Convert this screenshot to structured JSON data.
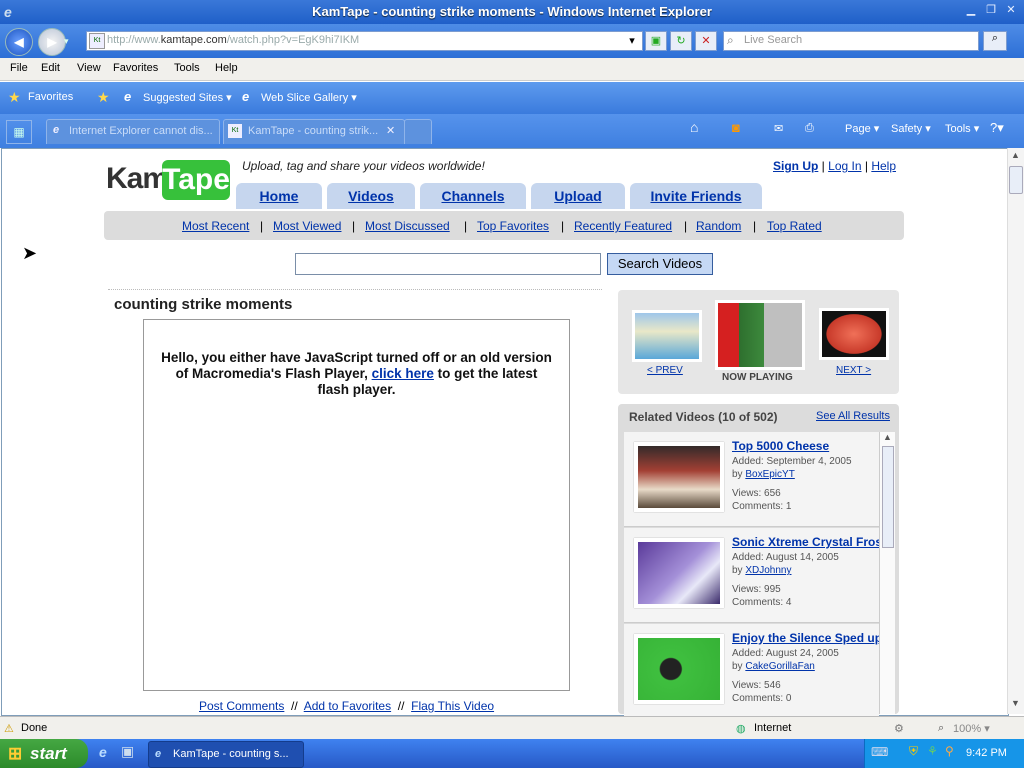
{
  "window": {
    "title": "KamTape - counting strike moments - Windows Internet Explorer"
  },
  "nav": {
    "url_prefix": "http://www.",
    "url_domain": "kamtape.com",
    "url_path": "/watch.php?v=EgK9hi7IKM",
    "search_placeholder": "Live Search"
  },
  "menu": {
    "items": [
      "File",
      "Edit",
      "View",
      "Favorites",
      "Tools",
      "Help"
    ]
  },
  "favbar": {
    "favorites": "Favorites",
    "suggested": "Suggested Sites ▾",
    "webslice": "Web Slice Gallery ▾"
  },
  "tabs": {
    "tab1": "Internet Explorer cannot dis...",
    "tab2": "KamTape - counting strik..."
  },
  "commandbar": {
    "page": "Page ▾",
    "safety": "Safety ▾",
    "tools": "Tools ▾"
  },
  "site": {
    "logo_a": "Kam",
    "logo_b": "Tape",
    "tagline": "Upload, tag and share your videos worldwide!",
    "account": {
      "signup": "Sign Up",
      "login": "Log In",
      "help": "Help",
      "sep": "|"
    },
    "maintabs": [
      "Home",
      "Videos",
      "Channels",
      "Upload",
      "Invite Friends"
    ],
    "subnav": [
      "Most Recent",
      "Most Viewed",
      "Most Discussed",
      "Top Favorites",
      "Recently Featured",
      "Random",
      "Top Rated"
    ],
    "search_button": "Search Videos",
    "video_title": "counting strike moments",
    "player_msg_a": "Hello, you either have JavaScript turned off or an old version of Macromedia's Flash Player, ",
    "player_msg_link": "click here",
    "player_msg_b": " to get the latest flash player.",
    "actions": {
      "post": "Post Comments",
      "fav": "Add to Favorites",
      "flag": "Flag This Video",
      "sep": "//"
    },
    "prev": "< PREV",
    "next": "NEXT >",
    "now_playing": "NOW PLAYING",
    "related_header": "Related Videos (10 of 502)",
    "see_all": "See All Results",
    "related": [
      {
        "title": "Top 5000 Cheese",
        "added": "Added: September 4, 2005",
        "by": "by",
        "user": "BoxEpicYT",
        "views": "Views: 656",
        "comments": "Comments: 1"
      },
      {
        "title": "Sonic Xtreme Crystal Frost",
        "added": "Added: August 14, 2005",
        "by": "by",
        "user": "XDJohnny",
        "views": "Views: 995",
        "comments": "Comments: 4"
      },
      {
        "title": "Enjoy the Silence Sped up",
        "added": "Added: August 24, 2005",
        "by": "by",
        "user": "CakeGorillaFan",
        "views": "Views: 546",
        "comments": "Comments: 0"
      }
    ]
  },
  "status": {
    "done": "Done",
    "zone": "Internet",
    "zoom": "100% ▾"
  },
  "taskbar": {
    "start": "start",
    "task": "KamTape - counting s...",
    "clock": "9:42 PM"
  }
}
